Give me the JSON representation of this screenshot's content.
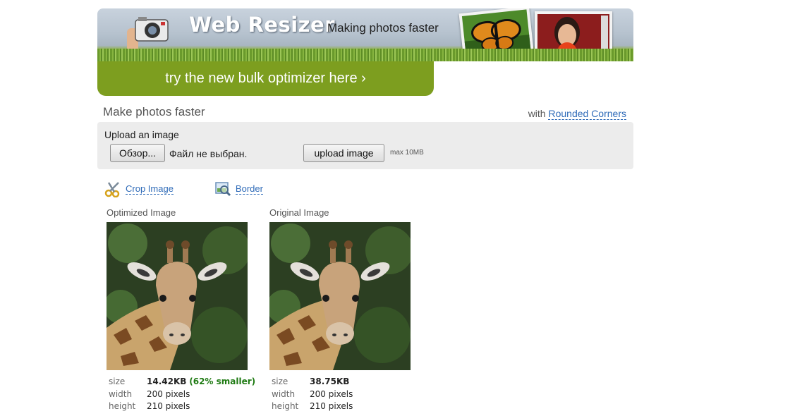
{
  "header": {
    "brand": "Web Resizer",
    "tagline": "Making photos faster",
    "promo": "try the new bulk optimizer here ›"
  },
  "main": {
    "title": "Make photos faster",
    "with_prefix": "with",
    "rounded_corners": "Rounded Corners"
  },
  "upload": {
    "label": "Upload an image",
    "browse_button": "Обзор...",
    "no_file": "Файл не выбран.",
    "upload_button": "upload image",
    "max_size": "max 10MB"
  },
  "tools": {
    "crop": "Crop Image",
    "border": "Border"
  },
  "optimized": {
    "heading": "Optimized Image",
    "size_label": "size",
    "size": "14.42KB",
    "savings": "(62% smaller)",
    "width_label": "width",
    "width": "200 pixels",
    "height_label": "height",
    "height": "210 pixels"
  },
  "original": {
    "heading": "Original Image",
    "size_label": "size",
    "size": "38.75KB",
    "width_label": "width",
    "width": "200 pixels",
    "height_label": "height",
    "height": "210 pixels"
  },
  "colors": {
    "promo_green": "#7d9e1f",
    "link_blue": "#2f6bb8",
    "savings_green": "#1e7a12"
  },
  "icons": [
    "camera-hand-icon",
    "scissors-icon",
    "magnifier-icon"
  ]
}
